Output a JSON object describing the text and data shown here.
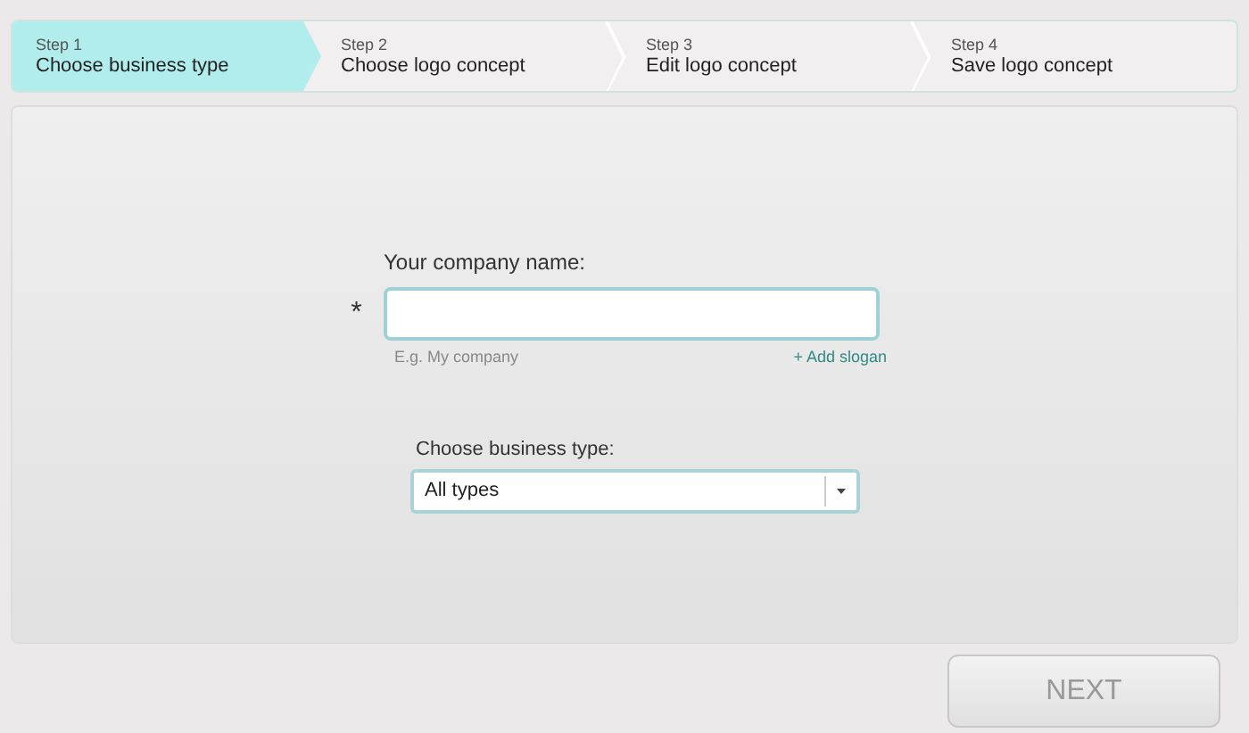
{
  "steps": [
    {
      "number": "Step 1",
      "label": "Choose business type",
      "selected": true
    },
    {
      "number": "Step 2",
      "label": "Choose logo concept",
      "selected": false
    },
    {
      "number": "Step 3",
      "label": "Edit logo concept",
      "selected": false
    },
    {
      "number": "Step 4",
      "label": "Save logo concept",
      "selected": false
    }
  ],
  "company_name": {
    "label": "Your company name:",
    "required_mark": "*",
    "hint": "E.g. My company",
    "add_slogan": "+ Add slogan"
  },
  "business_type": {
    "label": "Choose business type:",
    "value": "All types"
  },
  "next_button": {
    "label": "NEXT",
    "disabled": true
  }
}
